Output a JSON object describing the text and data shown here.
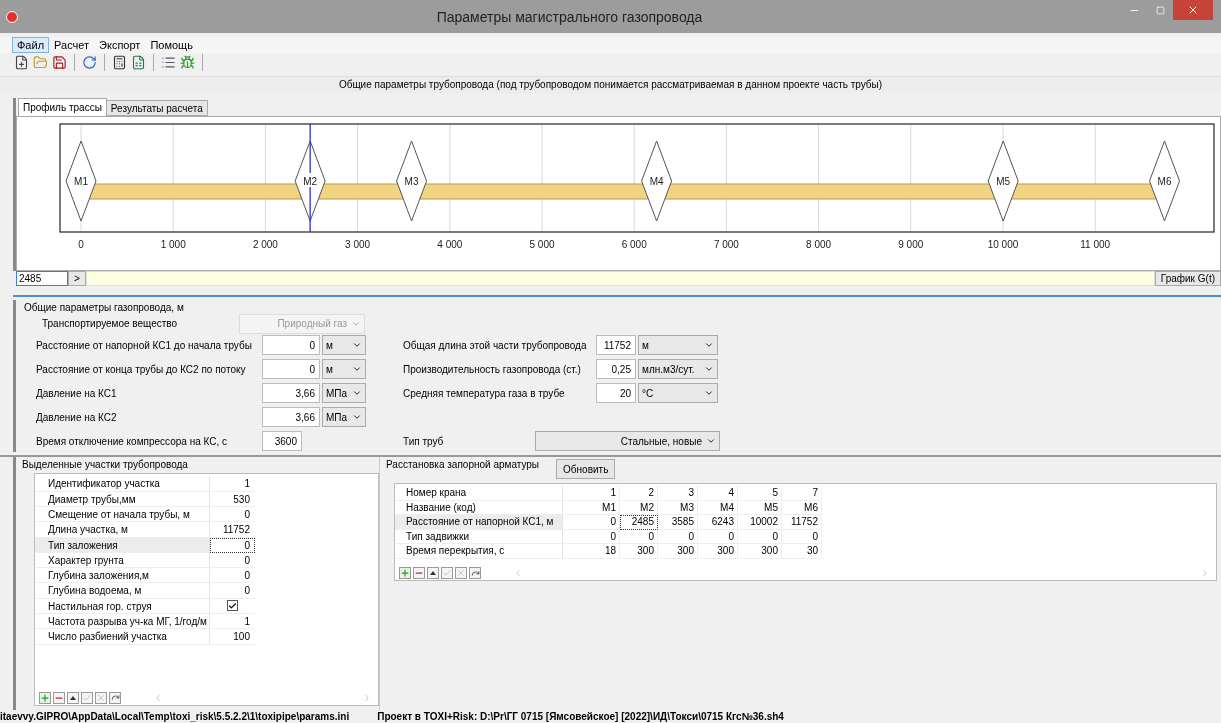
{
  "window": {
    "title": "Параметры магистрального газопровода"
  },
  "menu": [
    {
      "label": "Файл",
      "selected": true
    },
    {
      "label": "Расчет",
      "selected": false
    },
    {
      "label": "Экспорт",
      "selected": false
    },
    {
      "label": "Помощь",
      "selected": false
    }
  ],
  "header": "Общие параметры трубопровода (под трубопроводом понимается рассматриваемая в данном проекте часть трубы)",
  "tabs": [
    {
      "label": "Профиль трассы",
      "selected": true
    },
    {
      "label": "Результаты расчета",
      "selected": false
    }
  ],
  "profile": {
    "axis_labels": [
      "0",
      "1 000",
      "2 000",
      "3 000",
      "4 000",
      "5 000",
      "6 000",
      "7 000",
      "8 000",
      "9 000",
      "10 000",
      "11 000"
    ],
    "markers": [
      {
        "label": "M1"
      },
      {
        "label": "M2"
      },
      {
        "label": "M3"
      },
      {
        "label": "M4"
      },
      {
        "label": "M5"
      },
      {
        "label": "M6"
      }
    ]
  },
  "cursor_field": {
    "value": "2485"
  },
  "go_button": ">",
  "graph_button": "График G(t)",
  "params": {
    "title": "Общие параметры газопровода, м",
    "substance": {
      "label": "Транспортируемое вещество",
      "value": "Природный газ",
      "disabled": true
    },
    "left": [
      {
        "label": "Расстояние от напорной КС1 до начала трубы",
        "value": "0",
        "unit": "м"
      },
      {
        "label": "Расстояние от конца трубы до КС2 по потоку",
        "value": "0",
        "unit": "м"
      },
      {
        "label": "Давление на КС1",
        "value": "3,66",
        "unit": "МПа"
      },
      {
        "label": "Давление на КС2",
        "value": "3,66",
        "unit": "МПа"
      }
    ],
    "compressor": {
      "label": "Время отключение компрессора на КС, с",
      "value": "3600"
    },
    "right": [
      {
        "label": "Общая длина этой части трубопровода",
        "value": "11752",
        "unit": "м"
      },
      {
        "label": "Производительность газопровода (ст.)",
        "value": "0,25",
        "unit": "млн.м3/сут."
      },
      {
        "label": "Средняя температура газа в трубе",
        "value": "20",
        "unit": "°C"
      }
    ],
    "pipe_type": {
      "label": "Тип труб",
      "value": "Стальные, новые"
    }
  },
  "sections": {
    "title": "Выделенные участки трубопровода",
    "rows": [
      {
        "name": "Идентификатор участка",
        "kind": "number",
        "value": "1",
        "selected": false
      },
      {
        "name": "Диаметр трубы,мм",
        "kind": "number",
        "value": "530",
        "selected": false
      },
      {
        "name": "Смещение от начала трубы, м",
        "kind": "number",
        "value": "0",
        "selected": false
      },
      {
        "name": "Длина участка, м",
        "kind": "number",
        "value": "11752",
        "selected": false
      },
      {
        "name": "Тип заложения",
        "kind": "number",
        "value": "0",
        "selected": true
      },
      {
        "name": "Характер грунта",
        "kind": "number",
        "value": "0",
        "selected": false
      },
      {
        "name": "Глубина заложения,м",
        "kind": "number",
        "value": "0",
        "selected": false
      },
      {
        "name": "Глубина водоема, м",
        "kind": "number",
        "value": "0",
        "selected": false
      },
      {
        "name": "Настильная гор. струя",
        "kind": "check",
        "checked": true,
        "selected": false
      },
      {
        "name": "Частота разрыва уч-ка МГ, 1/год/м",
        "kind": "number",
        "value": "1",
        "selected": false
      },
      {
        "name": "Число разбиений участка",
        "kind": "number",
        "value": "100",
        "selected": false
      }
    ]
  },
  "valves": {
    "title": "Расстановка запорной арматуры",
    "refresh_button": "Обновить",
    "rows": [
      {
        "label": "Номер крана",
        "selected": false,
        "cells": [
          {
            "text": "1",
            "focused": false
          },
          {
            "text": "2",
            "focused": false
          },
          {
            "text": "3",
            "focused": false
          },
          {
            "text": "4",
            "focused": false
          },
          {
            "text": "5",
            "focused": false
          },
          {
            "text": "7",
            "focused": false
          }
        ]
      },
      {
        "label": "Название (код)",
        "selected": false,
        "cells": [
          {
            "text": "M1",
            "focused": false
          },
          {
            "text": "M2",
            "focused": false
          },
          {
            "text": "M3",
            "focused": false
          },
          {
            "text": "M4",
            "focused": false
          },
          {
            "text": "M5",
            "focused": false
          },
          {
            "text": "M6",
            "focused": false
          }
        ]
      },
      {
        "label": "Расстояние от напорной КС1, м",
        "selected": true,
        "cells": [
          {
            "text": "0",
            "focused": false
          },
          {
            "text": "2485",
            "focused": true
          },
          {
            "text": "3585",
            "focused": false
          },
          {
            "text": "6243",
            "focused": false
          },
          {
            "text": "10002",
            "focused": false
          },
          {
            "text": "11752",
            "focused": false
          }
        ]
      },
      {
        "label": "Тип задвижки",
        "selected": false,
        "cells": [
          {
            "text": "0",
            "focused": false
          },
          {
            "text": "0",
            "focused": false
          },
          {
            "text": "0",
            "focused": false
          },
          {
            "text": "0",
            "focused": false
          },
          {
            "text": "0",
            "focused": false
          },
          {
            "text": "0",
            "focused": false
          }
        ]
      },
      {
        "label": "Время перекрытия, с",
        "selected": false,
        "cells": [
          {
            "text": "18",
            "focused": false
          },
          {
            "text": "300",
            "focused": false
          },
          {
            "text": "300",
            "focused": false
          },
          {
            "text": "300",
            "focused": false
          },
          {
            "text": "300",
            "focused": false
          },
          {
            "text": "30",
            "focused": false
          }
        ]
      }
    ]
  },
  "status_bar": [
    "itaevvy.GIPRO\\AppData\\Local\\Temp\\toxi_risk\\5.5.2.2\\1\\toxipipe\\params.ini",
    "Проект в TOXI+Risk:  D:\\Pr\\ГГ 0715 [Ямсовейское] [2022]\\ИД\\Токси\\0715 Кгс№36.sh4"
  ]
}
